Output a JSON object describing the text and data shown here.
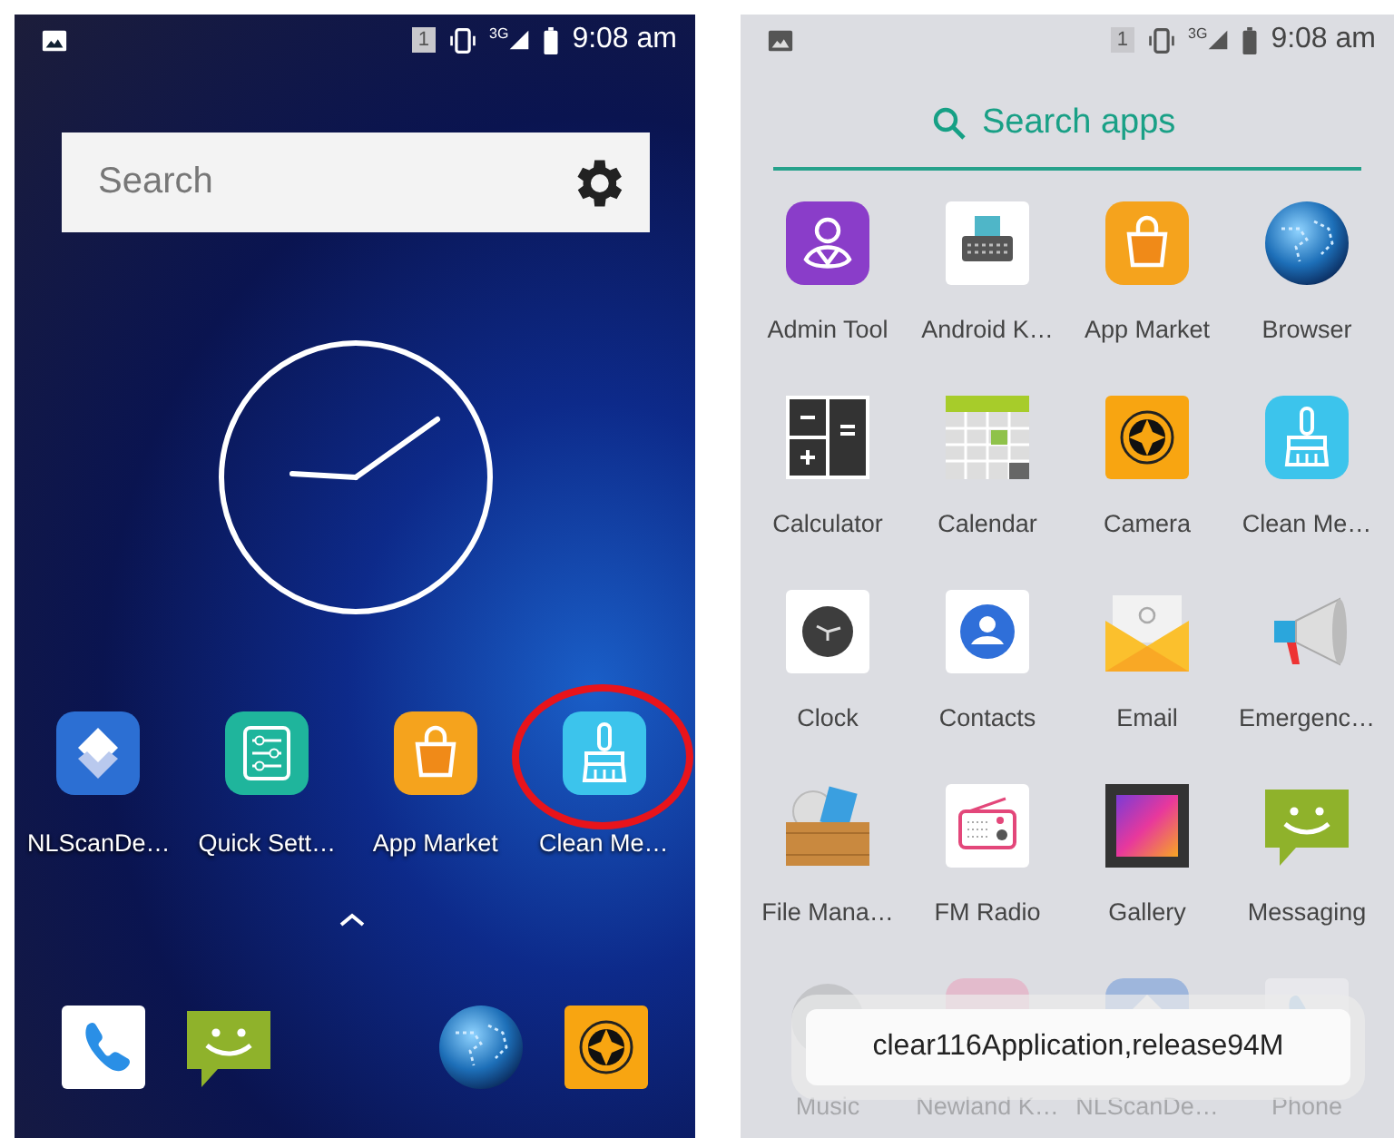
{
  "home_screen": {
    "status_bar": {
      "sim": "1",
      "network": "3G",
      "time": "9:08 am"
    },
    "search": {
      "placeholder": "Search"
    },
    "apps": [
      {
        "kind": "nlscan",
        "label": "NLScanDe…",
        "highlighted": false
      },
      {
        "kind": "sliders",
        "label": "Quick Sett…",
        "highlighted": false
      },
      {
        "kind": "market",
        "label": "App Market",
        "highlighted": false
      },
      {
        "kind": "cleaner",
        "label": "Clean Me…",
        "highlighted": true
      }
    ],
    "dock": [
      {
        "kind": "phone"
      },
      {
        "kind": "messaging"
      },
      {
        "kind": "browser"
      },
      {
        "kind": "camera"
      }
    ]
  },
  "app_drawer": {
    "status_bar": {
      "sim": "1",
      "network": "3G",
      "time": "9:08 am"
    },
    "search": {
      "placeholder": "Search apps"
    },
    "apps": [
      {
        "kind": "admin",
        "label": "Admin Tool",
        "faded": false
      },
      {
        "kind": "keyboard",
        "label": "Android K…",
        "faded": false
      },
      {
        "kind": "market",
        "label": "App Market",
        "faded": false
      },
      {
        "kind": "browser",
        "label": "Browser",
        "faded": false
      },
      {
        "kind": "calculator",
        "label": "Calculator",
        "faded": false
      },
      {
        "kind": "calendar",
        "label": "Calendar",
        "faded": false
      },
      {
        "kind": "camera",
        "label": "Camera",
        "faded": false
      },
      {
        "kind": "cleaner",
        "label": "Clean Me…",
        "faded": false
      },
      {
        "kind": "clock",
        "label": "Clock",
        "faded": false
      },
      {
        "kind": "contacts",
        "label": "Contacts",
        "faded": false
      },
      {
        "kind": "email",
        "label": "Email",
        "faded": false
      },
      {
        "kind": "megaphone",
        "label": "Emergenc…",
        "faded": false
      },
      {
        "kind": "files",
        "label": "File Mana…",
        "faded": false
      },
      {
        "kind": "radio",
        "label": "FM Radio",
        "faded": false
      },
      {
        "kind": "gallery",
        "label": "Gallery",
        "faded": false
      },
      {
        "kind": "messaging",
        "label": "Messaging",
        "faded": false
      },
      {
        "kind": "music",
        "label": "Music",
        "faded": true
      },
      {
        "kind": "keyboard_pink",
        "label": "Newland K…",
        "faded": true
      },
      {
        "kind": "nlscan",
        "label": "NLScanDe…",
        "faded": true
      },
      {
        "kind": "phone",
        "label": "Phone",
        "faded": true
      }
    ],
    "toast": "clear116Application,release94M"
  }
}
